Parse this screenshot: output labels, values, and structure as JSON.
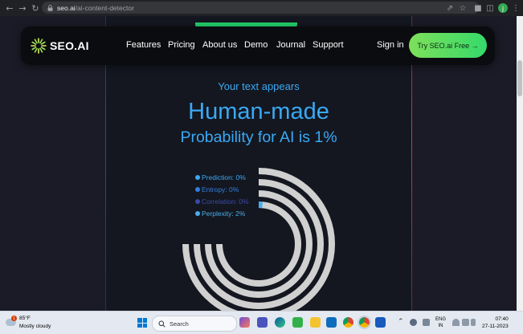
{
  "browser": {
    "url_domain": "seo.ai",
    "url_path": "/ai-content-detector",
    "profile_initial": "j",
    "icons": [
      "back-icon",
      "forward-icon",
      "reload-icon",
      "lock-icon",
      "share-icon",
      "star-icon",
      "extensions-icon",
      "sidebar-icon",
      "menu-icon"
    ]
  },
  "nav": {
    "logo_text": "SEO.AI",
    "links": [
      "Features",
      "Pricing",
      "About us",
      "Demo",
      "Journal",
      "Support"
    ],
    "sign_in": "Sign in",
    "cta": "Try SEO.ai Free →"
  },
  "result": {
    "subtitle": "Your text appears",
    "headline": "Human-made",
    "probability": "Probability for AI is 1%"
  },
  "chart_data": {
    "type": "radial-bar",
    "categories": [
      "Prediction",
      "Entropy",
      "Correlation",
      "Perplexity"
    ],
    "labels": [
      "Prediction: 0%",
      "Entropy: 0%",
      "Correlation: 0%",
      "Perplexity: 2%"
    ],
    "values": [
      0,
      0,
      0,
      2
    ],
    "max": 100,
    "colors": [
      "#3aa9f4",
      "#2f7fe0",
      "#3b4aa8",
      "#4aaee8"
    ],
    "track_color": "#d0d0d0"
  },
  "taskbar": {
    "weather_temp": "85°F",
    "weather_cond": "Mostly cloudy",
    "weather_badge": "1",
    "search_label": "Search",
    "lang_line1": "ENG",
    "lang_line2": "IN",
    "time": "07:40",
    "date": "27-11-2023"
  },
  "colors": {
    "accent": "#3aa9f4",
    "cta_start": "#7ee05a",
    "cta_end": "#35d96b",
    "nav_bg": "#0b0c0f",
    "page_bg": "#1b1b27"
  }
}
